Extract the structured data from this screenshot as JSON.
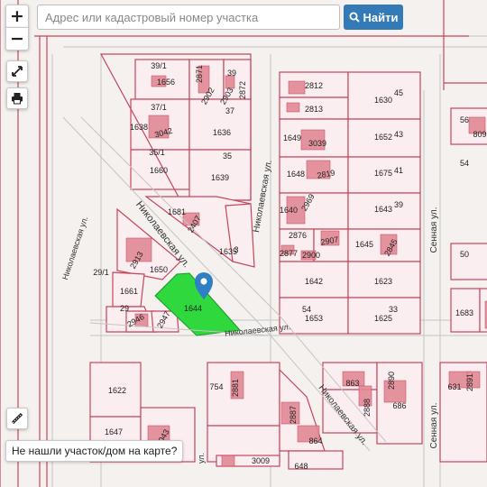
{
  "search": {
    "placeholder": "Адрес или кадастровый номер участка",
    "button_label": "Найти"
  },
  "controls": {
    "zoom_in": "+",
    "zoom_out": "−"
  },
  "not_found_link": "Не нашли участок/дом на карте?",
  "colors": {
    "selected_parcel": "#2fd83d",
    "boundary": "#c8455b",
    "building": "#e08a96",
    "pin": "#2f7fc4"
  },
  "streets": [
    {
      "id": "s1",
      "name": "Николаевская ул."
    },
    {
      "id": "s2",
      "name": "Николаевская ул."
    },
    {
      "id": "s3",
      "name": "Николаевская ул."
    },
    {
      "id": "s4",
      "name": "Николаевская ул."
    },
    {
      "id": "s5",
      "name": "Николаевская ул."
    },
    {
      "id": "s6",
      "name": "Сенная ул."
    },
    {
      "id": "s7",
      "name": "Сенная ул."
    },
    {
      "id": "s8",
      "name": "ул."
    }
  ],
  "selected_parcel": "1644",
  "labels": [
    "39/1",
    "1656",
    "2871",
    "2902",
    "2903",
    "39",
    "2872",
    "37/1",
    "37",
    "1638",
    "3042",
    "1636",
    "35/1",
    "35",
    "1660",
    "1639",
    "1681",
    "2407",
    "1635",
    "3",
    "2913",
    "1650",
    "29/1",
    "1661",
    "29",
    "2946",
    "2947",
    "1644",
    "2812",
    "45",
    "1630",
    "2813",
    "1649",
    "3039",
    "1652",
    "43",
    "1648",
    "2819",
    "1675",
    "41",
    "1640",
    "2969",
    "1643",
    "39",
    "2876",
    "2907",
    "1645",
    "2845",
    "2877",
    "2900",
    "1642",
    "1623",
    "1653",
    "1625",
    "54",
    "33",
    "56",
    "809",
    "54",
    "50",
    "1683",
    "1622",
    "1647",
    "3043",
    "754",
    "2881",
    "2887",
    "864",
    "3009",
    "648",
    "863",
    "2888",
    "2890",
    "686",
    "631",
    "2891"
  ]
}
